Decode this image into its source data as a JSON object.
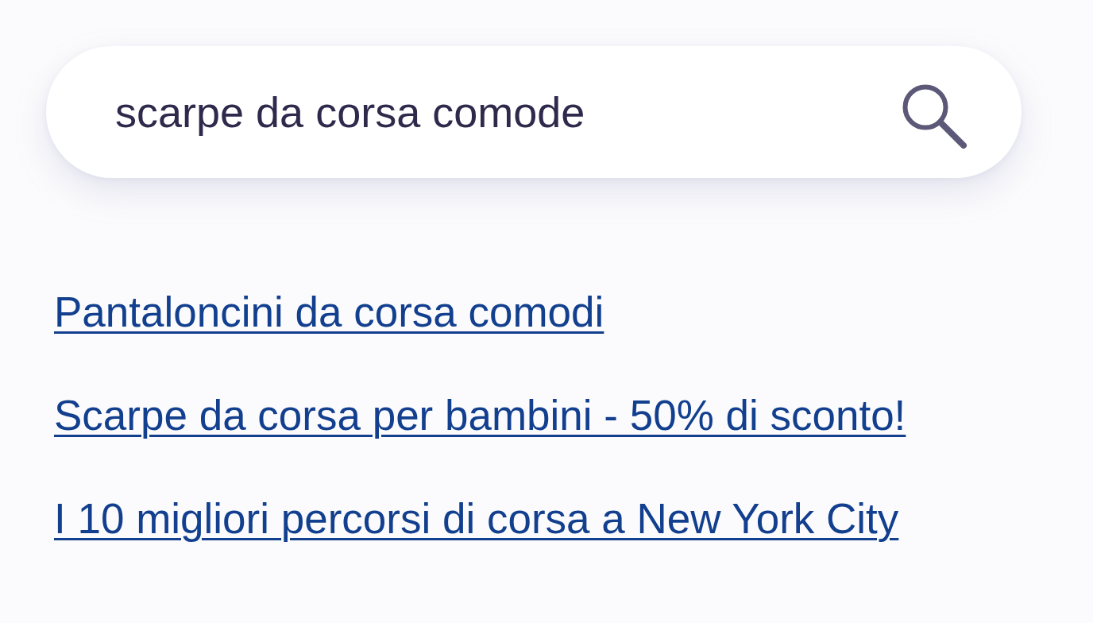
{
  "search": {
    "value": "scarpe da corsa comode"
  },
  "links": [
    "Pantaloncini da corsa comodi",
    "Scarpe da corsa per bambini - 50% di sconto!",
    "I 10 migliori percorsi di corsa a New York City"
  ]
}
